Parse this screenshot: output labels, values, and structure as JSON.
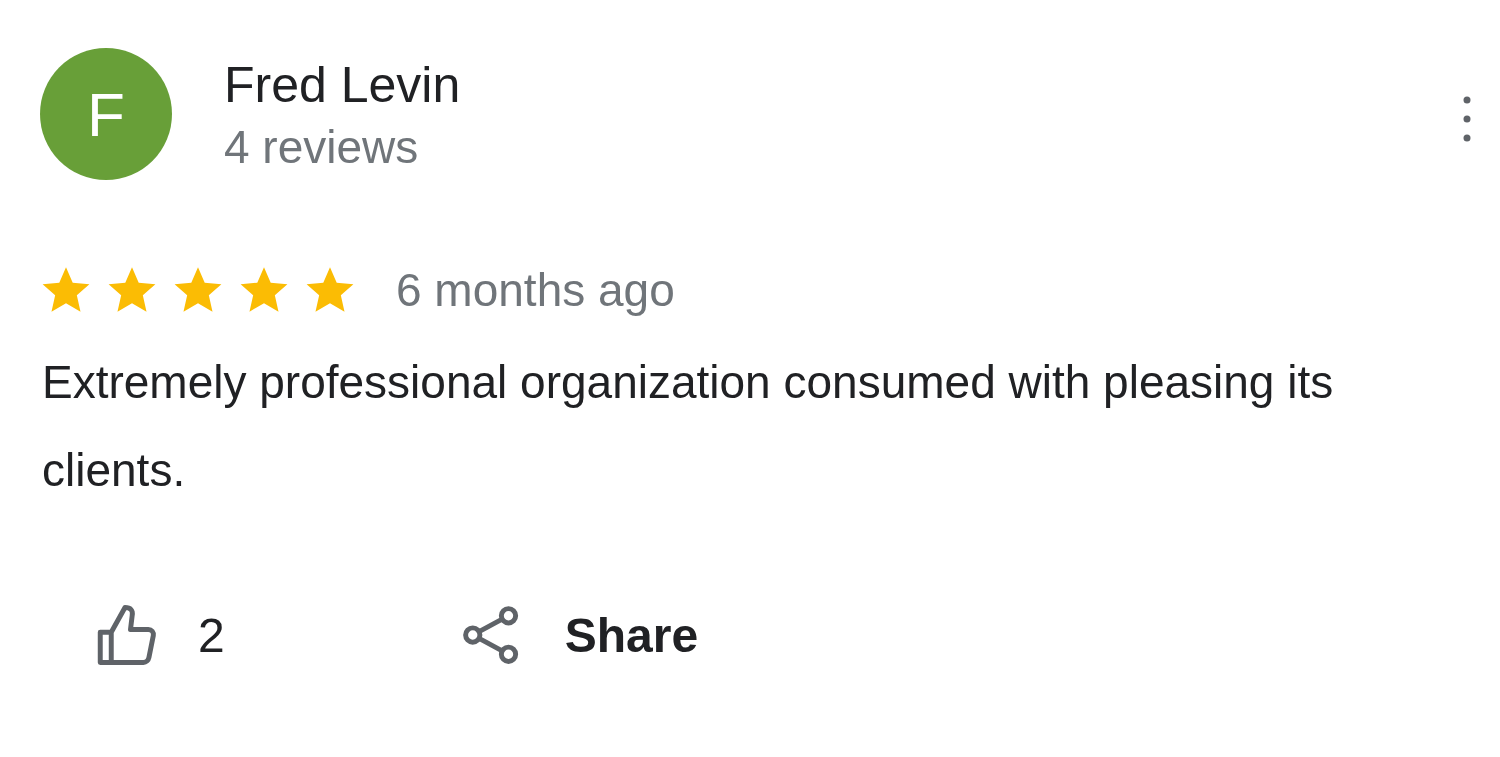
{
  "review": {
    "avatar_letter": "F",
    "author": "Fred Levin",
    "review_count": "4 reviews",
    "stars": 5,
    "time": "6 months ago",
    "text": "Extremely professional organization consumed with pleasing its clients."
  },
  "actions": {
    "likes": "2",
    "share": "Share"
  }
}
